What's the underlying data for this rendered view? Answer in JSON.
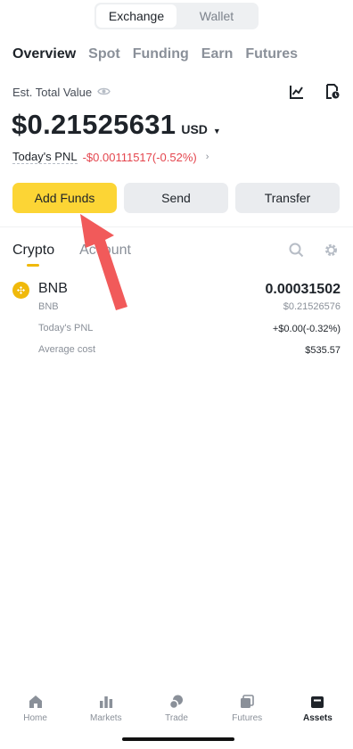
{
  "switcher": {
    "exchange": "Exchange",
    "wallet": "Wallet"
  },
  "tabs": [
    "Overview",
    "Spot",
    "Funding",
    "Earn",
    "Futures"
  ],
  "overview": {
    "est_label": "Est. Total Value",
    "total": "$0.21525631",
    "currency": "USD",
    "pnl_label": "Today's PNL",
    "pnl_value": "-$0.00111517(-0.52%)"
  },
  "actions": {
    "add_funds": "Add Funds",
    "send": "Send",
    "transfer": "Transfer"
  },
  "subtabs": {
    "crypto": "Crypto",
    "account": "Account"
  },
  "asset": {
    "symbol": "BNB",
    "name": "BNB",
    "amount": "0.00031502",
    "usd_value": "$0.21526576",
    "pnl_label": "Today's PNL",
    "pnl_value": "+$0.00(-0.32%)",
    "avg_label": "Average cost",
    "avg_value": "$535.57"
  },
  "nav": [
    "Home",
    "Markets",
    "Trade",
    "Futures",
    "Assets"
  ],
  "colors": {
    "brand": "#fcd535",
    "negative": "#e4464e",
    "annotation_arrow": "#f15a5a"
  }
}
